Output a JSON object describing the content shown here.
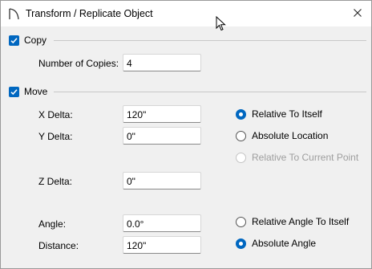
{
  "window": {
    "title": "Transform / Replicate Object"
  },
  "copy": {
    "label": "Copy",
    "checked": true,
    "copies_label": "Number of Copies:",
    "copies_value": "4"
  },
  "move": {
    "label": "Move",
    "checked": true,
    "x_label": "X Delta:",
    "x_value": "120\"",
    "y_label": "Y Delta:",
    "y_value": "0\"",
    "z_label": "Z Delta:",
    "z_value": "0\"",
    "angle_label": "Angle:",
    "angle_value": "0.0°",
    "distance_label": "Distance:",
    "distance_value": "120\"",
    "relative_itself": "Relative To Itself",
    "absolute_location": "Absolute Location",
    "relative_current_point": "Relative To Current Point",
    "relative_angle": "Relative Angle To Itself",
    "absolute_angle": "Absolute Angle"
  },
  "colors": {
    "accent": "#0067c0",
    "disabled_text": "#9e9e9e",
    "background": "#f0f0f0"
  },
  "icons": {
    "app": "arc-door-icon",
    "close": "close-icon",
    "cursor": "mouse-pointer-icon",
    "check": "checkmark-icon"
  }
}
